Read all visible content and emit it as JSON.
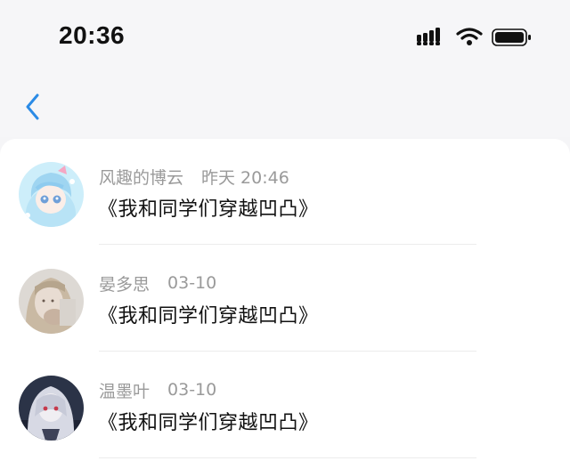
{
  "status_bar": {
    "time": "20:36",
    "icons": [
      "signal-icon",
      "wifi-icon",
      "battery-icon"
    ]
  },
  "nav": {
    "back_icon": "chevron-left-icon",
    "accent_color": "#2b8be6"
  },
  "list": [
    {
      "name": "风趣的博云",
      "time": "昨天 20:46",
      "title": "《我和同学们穿越凹凸》"
    },
    {
      "name": "晏多思",
      "time": "03-10",
      "title": "《我和同学们穿越凹凸》"
    },
    {
      "name": "温墨叶",
      "time": "03-10",
      "title": "《我和同学们穿越凹凸》"
    }
  ]
}
